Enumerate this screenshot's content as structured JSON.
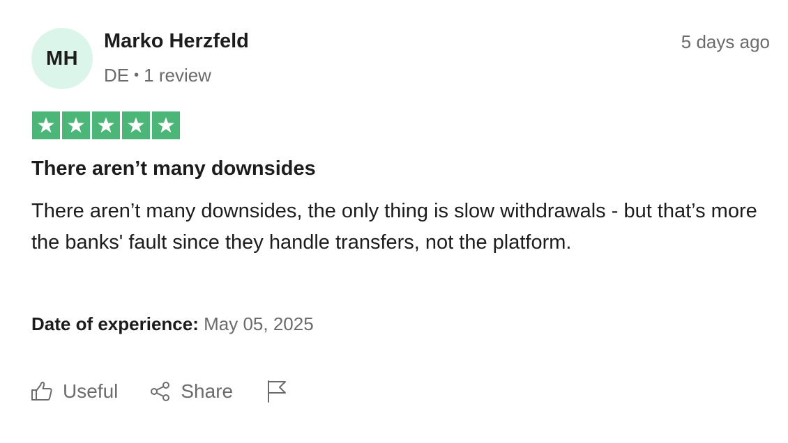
{
  "reviewer": {
    "initials": "MH",
    "name": "Marko Herzfeld",
    "country": "DE",
    "separator": "•",
    "review_count": "1 review"
  },
  "timestamp": "5 days ago",
  "rating": {
    "stars": 5,
    "max": 5,
    "color": "#4bb678"
  },
  "review": {
    "title": "There aren’t many downsides",
    "body": "There aren’t many downsides, the only thing is slow withdrawals - but that’s more the banks' fault since they handle transfers, not the platform."
  },
  "experience": {
    "label": "Date of experience:",
    "date": "May 05, 2025"
  },
  "actions": {
    "useful_label": "Useful",
    "useful_icon": "thumbs-up-icon",
    "share_label": "Share",
    "share_icon": "share-icon",
    "report_icon": "flag-icon"
  },
  "colors": {
    "avatar_bg": "#dcf5ea",
    "muted_text": "#6b6b6b",
    "primary_text": "#1c1c1c"
  }
}
